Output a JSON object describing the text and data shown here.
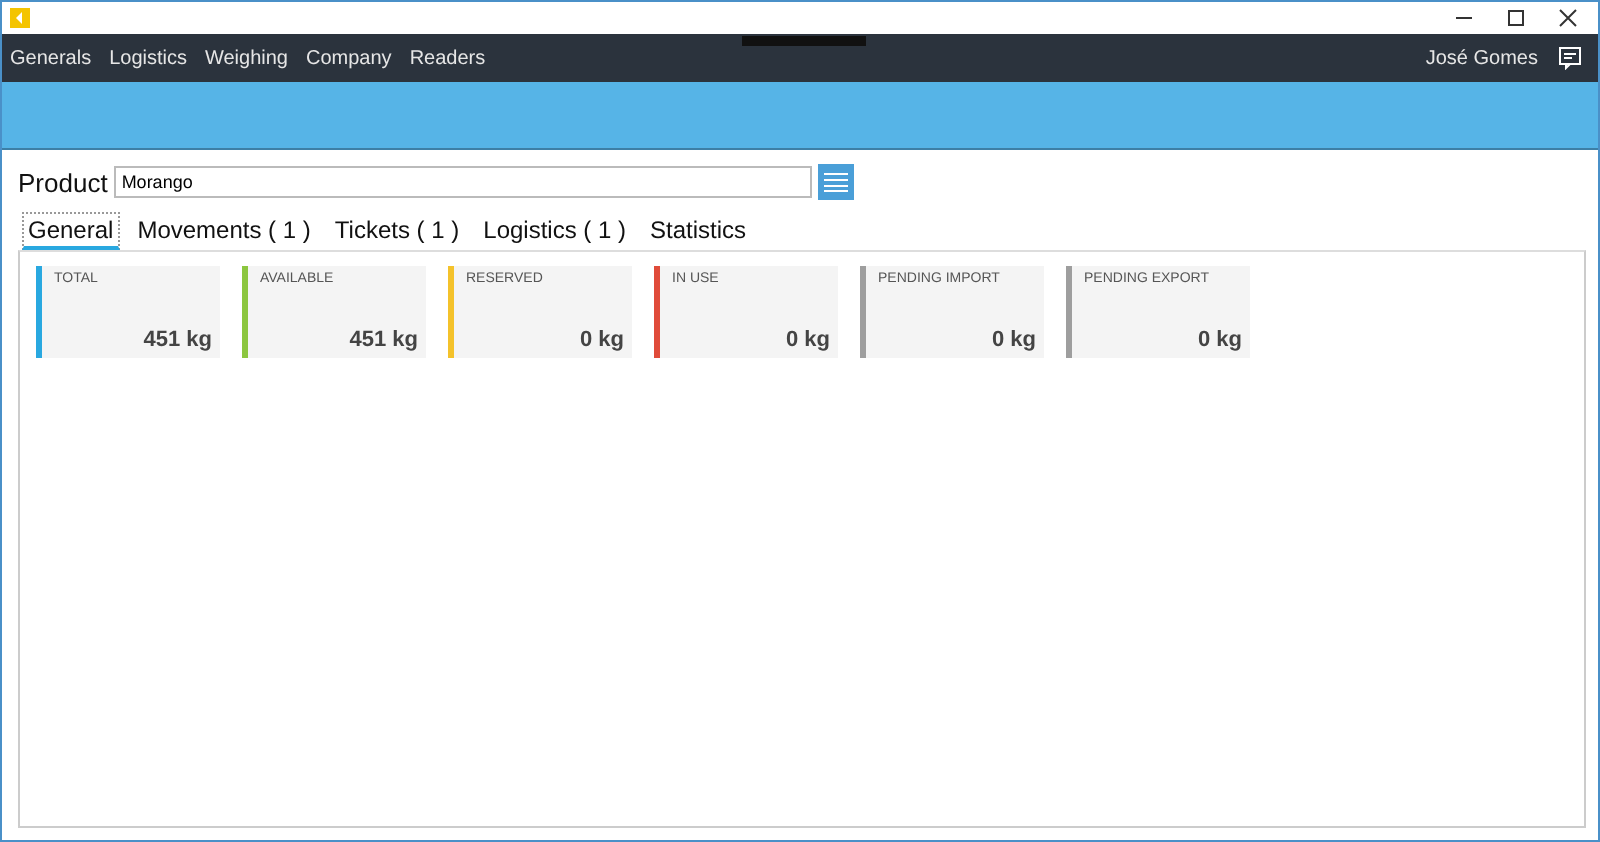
{
  "menu": [
    {
      "label": "Generals"
    },
    {
      "label": "Logistics"
    },
    {
      "label": "Weighing"
    },
    {
      "label": "Company"
    },
    {
      "label": "Readers"
    }
  ],
  "user": "José Gomes",
  "product": {
    "label": "Product",
    "value": "Morango"
  },
  "tabs": [
    {
      "label": "General",
      "selected": true
    },
    {
      "label": "Movements ( 1 )",
      "selected": false
    },
    {
      "label": "Tickets ( 1 )",
      "selected": false
    },
    {
      "label": "Logistics ( 1 )",
      "selected": false
    },
    {
      "label": "Statistics",
      "selected": false
    }
  ],
  "cards": [
    {
      "title": "TOTAL",
      "value": "451 kg",
      "color": "#29a8e0"
    },
    {
      "title": "AVAILABLE",
      "value": "451 kg",
      "color": "#8cc63f"
    },
    {
      "title": "RESERVED",
      "value": "0 kg",
      "color": "#f4c22b"
    },
    {
      "title": "IN USE",
      "value": "0 kg",
      "color": "#e04b3a"
    },
    {
      "title": "PENDING IMPORT",
      "value": "0 kg",
      "color": "#9e9e9e"
    },
    {
      "title": "PENDING EXPORT",
      "value": "0 kg",
      "color": "#9e9e9e"
    }
  ]
}
